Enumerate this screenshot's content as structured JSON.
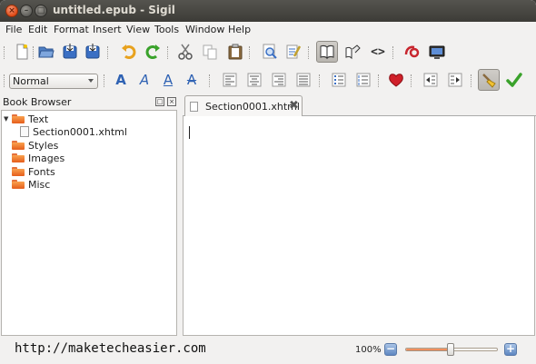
{
  "window": {
    "title": "untitled.epub - Sigil",
    "close_glyph": "×",
    "minimize_glyph": "–",
    "maximize_glyph": "□"
  },
  "menubar": {
    "items": [
      {
        "label": "File"
      },
      {
        "label": "Edit"
      },
      {
        "label": "Format"
      },
      {
        "label": "Insert"
      },
      {
        "label": "View"
      },
      {
        "label": "Tools"
      },
      {
        "label": "Window"
      },
      {
        "label": "Help"
      }
    ]
  },
  "toolbar1": {
    "buttons": [
      {
        "icon": "new-file-icon"
      },
      {
        "icon": "open-folder-icon"
      },
      {
        "icon": "save-icon"
      },
      {
        "icon": "save-as-icon"
      },
      {
        "icon": "undo-icon"
      },
      {
        "icon": "redo-icon"
      },
      {
        "icon": "cut-icon"
      },
      {
        "icon": "copy-icon"
      },
      {
        "icon": "paste-icon"
      },
      {
        "icon": "find-icon"
      },
      {
        "icon": "spellcheck-icon"
      },
      {
        "icon": "book-view-icon",
        "active": true
      },
      {
        "icon": "split-view-icon"
      },
      {
        "icon": "code-view-icon",
        "glyph": "<>"
      },
      {
        "icon": "meta-editor-icon"
      },
      {
        "icon": "preview-icon"
      }
    ]
  },
  "toolbar2": {
    "heading_style": {
      "selected": "Normal"
    },
    "buttons": [
      {
        "icon": "bold-icon",
        "glyph": "A"
      },
      {
        "icon": "italic-icon",
        "glyph": "A"
      },
      {
        "icon": "underline-icon",
        "glyph": "A"
      },
      {
        "icon": "strikethrough-icon",
        "glyph": "A"
      },
      {
        "icon": "align-left-icon"
      },
      {
        "icon": "align-center-icon"
      },
      {
        "icon": "align-right-icon"
      },
      {
        "icon": "justify-icon"
      },
      {
        "icon": "bullet-list-icon"
      },
      {
        "icon": "numbered-list-icon"
      },
      {
        "icon": "heart-icon"
      },
      {
        "icon": "decrease-indent-icon"
      },
      {
        "icon": "increase-indent-icon"
      },
      {
        "icon": "clean-source-icon",
        "active": true
      },
      {
        "icon": "check-icon"
      }
    ]
  },
  "book_browser": {
    "title": "Book Browser",
    "float_glyph": "□",
    "close_glyph": "×",
    "tree": [
      {
        "label": "Text",
        "type": "folder",
        "expanded": true,
        "expander_glyph": "▼"
      },
      {
        "label": "Section0001.xhtml",
        "type": "file"
      },
      {
        "label": "Styles",
        "type": "folder"
      },
      {
        "label": "Images",
        "type": "folder"
      },
      {
        "label": "Fonts",
        "type": "folder"
      },
      {
        "label": "Misc",
        "type": "folder"
      }
    ]
  },
  "editor": {
    "tab": {
      "label": "Section0001.xhtml",
      "close_glyph": "✖"
    }
  },
  "statusbar": {
    "url": "http://maketecheasier.com",
    "zoom": "100%",
    "zoom_out_glyph": "−",
    "zoom_in_glyph": "+",
    "zoom_slider_fraction": 0.5
  },
  "colors": {
    "accent_orange": "#e55d1b",
    "icon_blue": "#3a6fc4",
    "heart_red": "#d0202a",
    "check_green": "#3aa22b"
  }
}
